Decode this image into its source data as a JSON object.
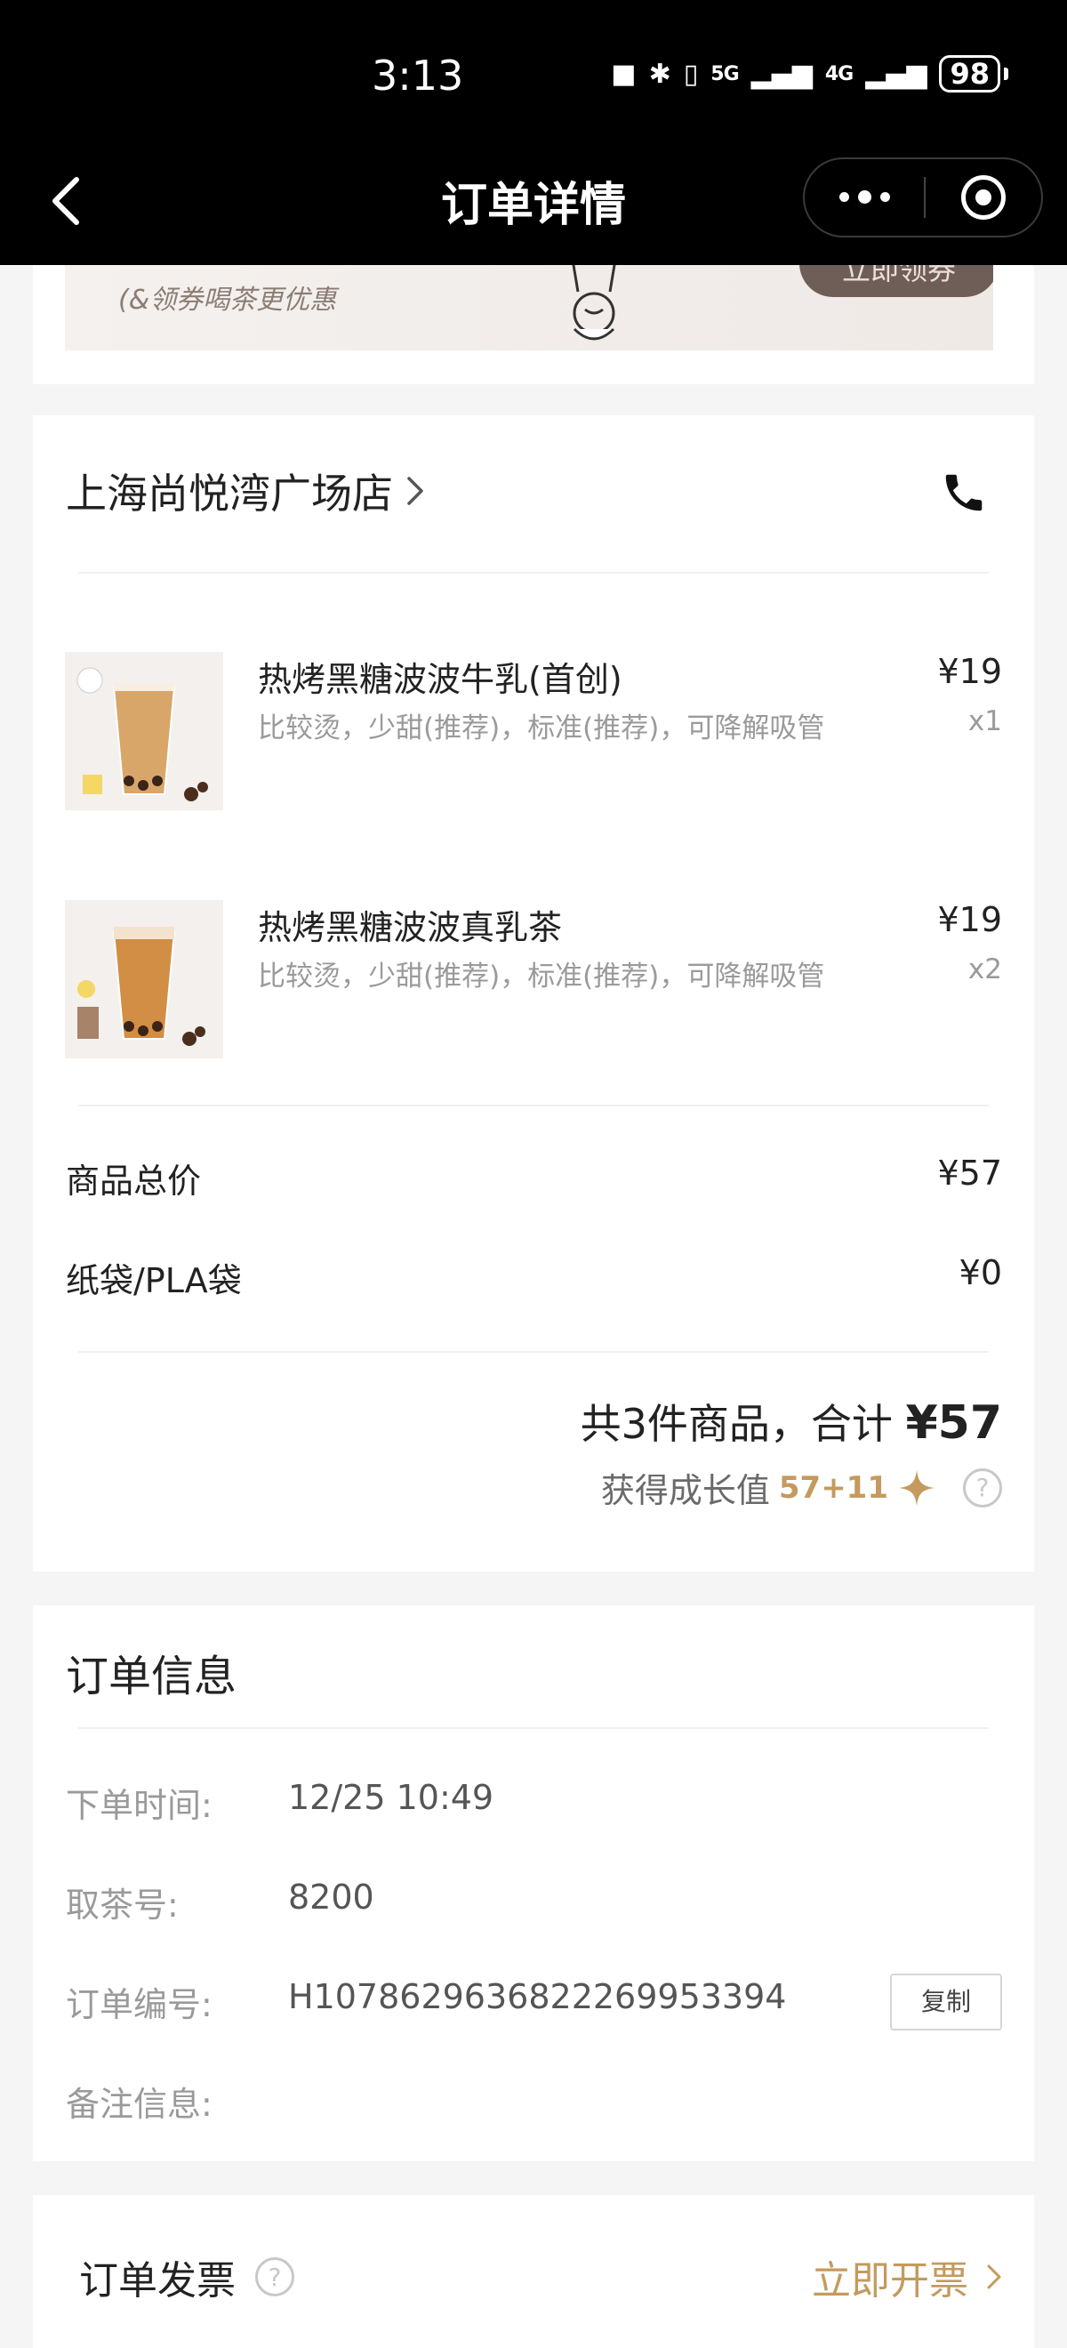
{
  "status_bar": {
    "time": "3:13",
    "network_5g": "5G",
    "network_4g": "4G",
    "battery": "98"
  },
  "nav": {
    "title": "订单详情"
  },
  "promo": {
    "text": "&领券喝茶更优惠",
    "button": "立即领券"
  },
  "store": {
    "name": "上海尚悦湾广场店"
  },
  "items": [
    {
      "name": "热烤黑糖波波牛乳(首创)",
      "spec": "比较烫，少甜(推荐)，标准(推荐)，可降解吸管",
      "price": "¥19",
      "qty": "x1"
    },
    {
      "name": "热烤黑糖波波真乳茶",
      "spec": "比较烫，少甜(推荐)，标准(推荐)，可降解吸管",
      "price": "¥19",
      "qty": "x2"
    }
  ],
  "fees": [
    {
      "label": "商品总价",
      "value": "¥57"
    },
    {
      "label": "纸袋/PLA袋",
      "value": "¥0"
    }
  ],
  "summary": {
    "count_text": "共3件商品，合计 ",
    "total": "¥57",
    "growth_label": "获得成长值",
    "growth_value": "57+11"
  },
  "order_info": {
    "title": "订单信息",
    "rows": [
      {
        "label": "下单时间:",
        "value": "12/25 10:49"
      },
      {
        "label": "取茶号:",
        "value": "8200"
      },
      {
        "label": "订单编号:",
        "value": "H1078629636822269953394"
      },
      {
        "label": "备注信息:",
        "value": ""
      }
    ],
    "copy_button": "复制"
  },
  "invoice": {
    "title": "订单发票",
    "action": "立即开票"
  },
  "colors": {
    "accent_gold": "#c49a5e",
    "topbar": "#000000",
    "background": "#f5f5f5"
  }
}
